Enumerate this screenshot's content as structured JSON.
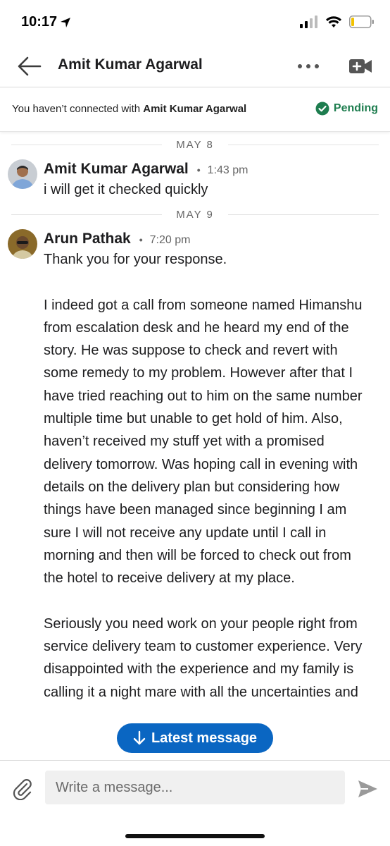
{
  "status_bar": {
    "time": "10:17"
  },
  "header": {
    "title": "Amit Kumar Agarwal",
    "icons": [
      "back-arrow-icon",
      "more-icon",
      "video-call-icon"
    ]
  },
  "banner": {
    "prefix": "You haven’t connected with ",
    "name": "Amit Kumar Agarwal",
    "status": "Pending",
    "status_color": "#1e7d4f"
  },
  "conversation": {
    "dates": [
      "MAY 8",
      "MAY 9"
    ],
    "messages": [
      {
        "sender": "Amit Kumar Agarwal",
        "time": "1:43 pm",
        "paragraphs": [
          "i will get it checked quickly"
        ]
      },
      {
        "sender": "Arun Pathak",
        "time": "7:20 pm",
        "paragraphs": [
          "Thank you for your response.",
          "I indeed got a call from someone named Himanshu from escalation desk and he heard my end of the story. He was suppose to check and revert with some remedy to my problem. However after that I have tried reaching out to him on the same number multiple time but unable to get hold of him. Also, haven’t received my stuff yet with a promised delivery tomorrow. Was hoping call in evening with details on the delivery plan but considering how things have been managed since beginning I am sure I will not receive any update until I call in morning and then will be forced to check out from the hotel to receive delivery at my place.",
          "Seriously you need work on your people right from service delivery team to customer experience. Very disappointed with the experience and my family is calling it a night mare with all the uncertainties and"
        ]
      }
    ]
  },
  "latest_pill": {
    "label": "Latest message",
    "color": "#0a66c2"
  },
  "composer": {
    "placeholder": "Write a message..."
  }
}
